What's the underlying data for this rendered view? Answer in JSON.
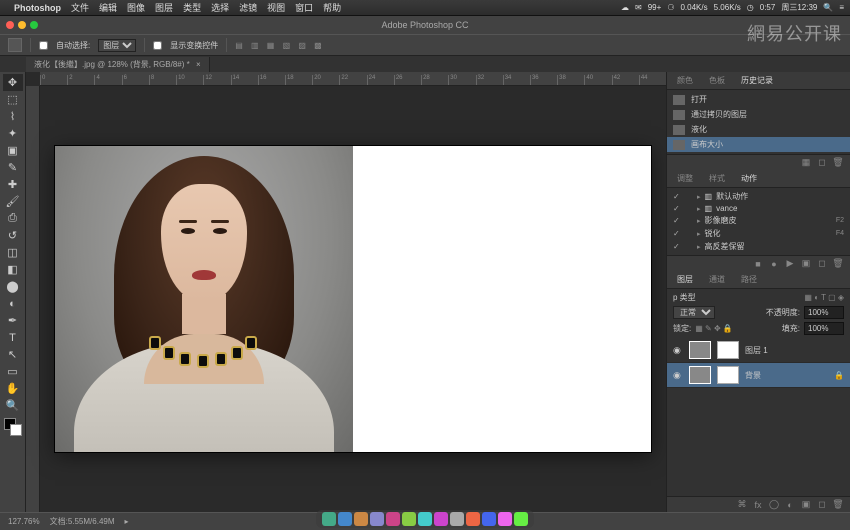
{
  "mac_menu": {
    "app": "Photoshop",
    "items": [
      "文件",
      "编辑",
      "图像",
      "图层",
      "类型",
      "选择",
      "滤镜",
      "视图",
      "窗口",
      "帮助"
    ],
    "right": {
      "battery": "99+",
      "net_up": "0.04K/s",
      "net_down": "5.06K/s",
      "time": "0:57",
      "date": "周三12:39"
    }
  },
  "titlebar": {
    "title": "Adobe Photoshop CC"
  },
  "optionsbar": {
    "auto_select_label": "自动选择:",
    "auto_select_value": "图层",
    "transform_label": "显示变换控件"
  },
  "doc_tab": "液化【後繼】.jpg @ 128% (背景, RGB/8#) *",
  "ruler_ticks": [
    "0",
    "2",
    "4",
    "6",
    "8",
    "10",
    "12",
    "14",
    "16",
    "18",
    "20",
    "22",
    "24",
    "26",
    "28",
    "30",
    "32",
    "34",
    "36",
    "38",
    "40",
    "42",
    "44"
  ],
  "history_panel": {
    "tabs": [
      "颜色",
      "色板",
      "历史记录"
    ],
    "items": [
      {
        "label": "打开",
        "active": false
      },
      {
        "label": "通过拷贝的图层",
        "active": false
      },
      {
        "label": "液化",
        "active": false
      },
      {
        "label": "画布大小",
        "active": true
      }
    ]
  },
  "actions_panel": {
    "tabs": [
      "调整",
      "样式",
      "动作"
    ],
    "items": [
      {
        "label": "默认动作",
        "folder": true,
        "fkey": ""
      },
      {
        "label": "vance",
        "folder": true,
        "fkey": ""
      },
      {
        "label": "影像磨皮",
        "folder": false,
        "fkey": "F2"
      },
      {
        "label": "锐化",
        "folder": false,
        "fkey": "F4"
      },
      {
        "label": "高反差保留",
        "folder": false,
        "fkey": ""
      }
    ]
  },
  "layers_panel": {
    "tabs": [
      "图层",
      "通道",
      "路径"
    ],
    "kind_label": "p 类型",
    "blend": "正常",
    "opacity_label": "不透明度:",
    "opacity": "100%",
    "lock_label": "锁定:",
    "fill_label": "填充:",
    "fill": "100%",
    "layers": [
      {
        "name": "图层 1",
        "locked": false,
        "active": false
      },
      {
        "name": "背景",
        "locked": true,
        "active": true
      }
    ]
  },
  "statusbar": {
    "zoom": "127.76%",
    "info": "文档:5.55M/6.49M"
  },
  "watermark": "網易公开课",
  "dock_colors": [
    "#4a8",
    "#48c",
    "#c84",
    "#88c",
    "#c48",
    "#8c4",
    "#4cc",
    "#c4c",
    "#aaa",
    "#e64",
    "#46e",
    "#e6e",
    "#6e4"
  ]
}
